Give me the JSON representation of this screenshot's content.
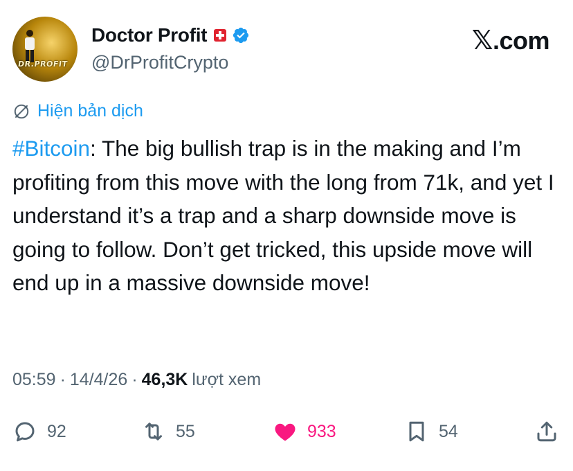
{
  "author": {
    "display_name": "Doctor Profit",
    "handle": "@DrProfitCrypto",
    "avatar_text": "DR.PROFIT",
    "flag_icon": "swiss-flag-icon",
    "verified_icon": "verified-badge-icon"
  },
  "brand": {
    "label": ".com",
    "icon": "x-logo"
  },
  "translate": {
    "label": "Hiện bản dịch",
    "icon": "translate-globe-icon"
  },
  "tweet": {
    "hashtag": "#Bitcoin",
    "text": ": The big bullish trap is in the making and I’m profiting from this move with the long from 71k, and yet I understand it’s a trap and a sharp downside move is going to follow. Don’t get tricked, this upside move will end up in a massive downside move!"
  },
  "meta": {
    "time": "05:59",
    "separator1": "·",
    "date": "14/4/26",
    "separator2": "·",
    "views": "46,3K",
    "views_label": "lượt xem"
  },
  "actions": {
    "replies": "92",
    "reposts": "55",
    "likes": "933",
    "bookmarks": "54"
  },
  "colors": {
    "accent": "#1d9bf0",
    "like": "#f91880",
    "muted": "#536471",
    "text": "#0f1419"
  }
}
